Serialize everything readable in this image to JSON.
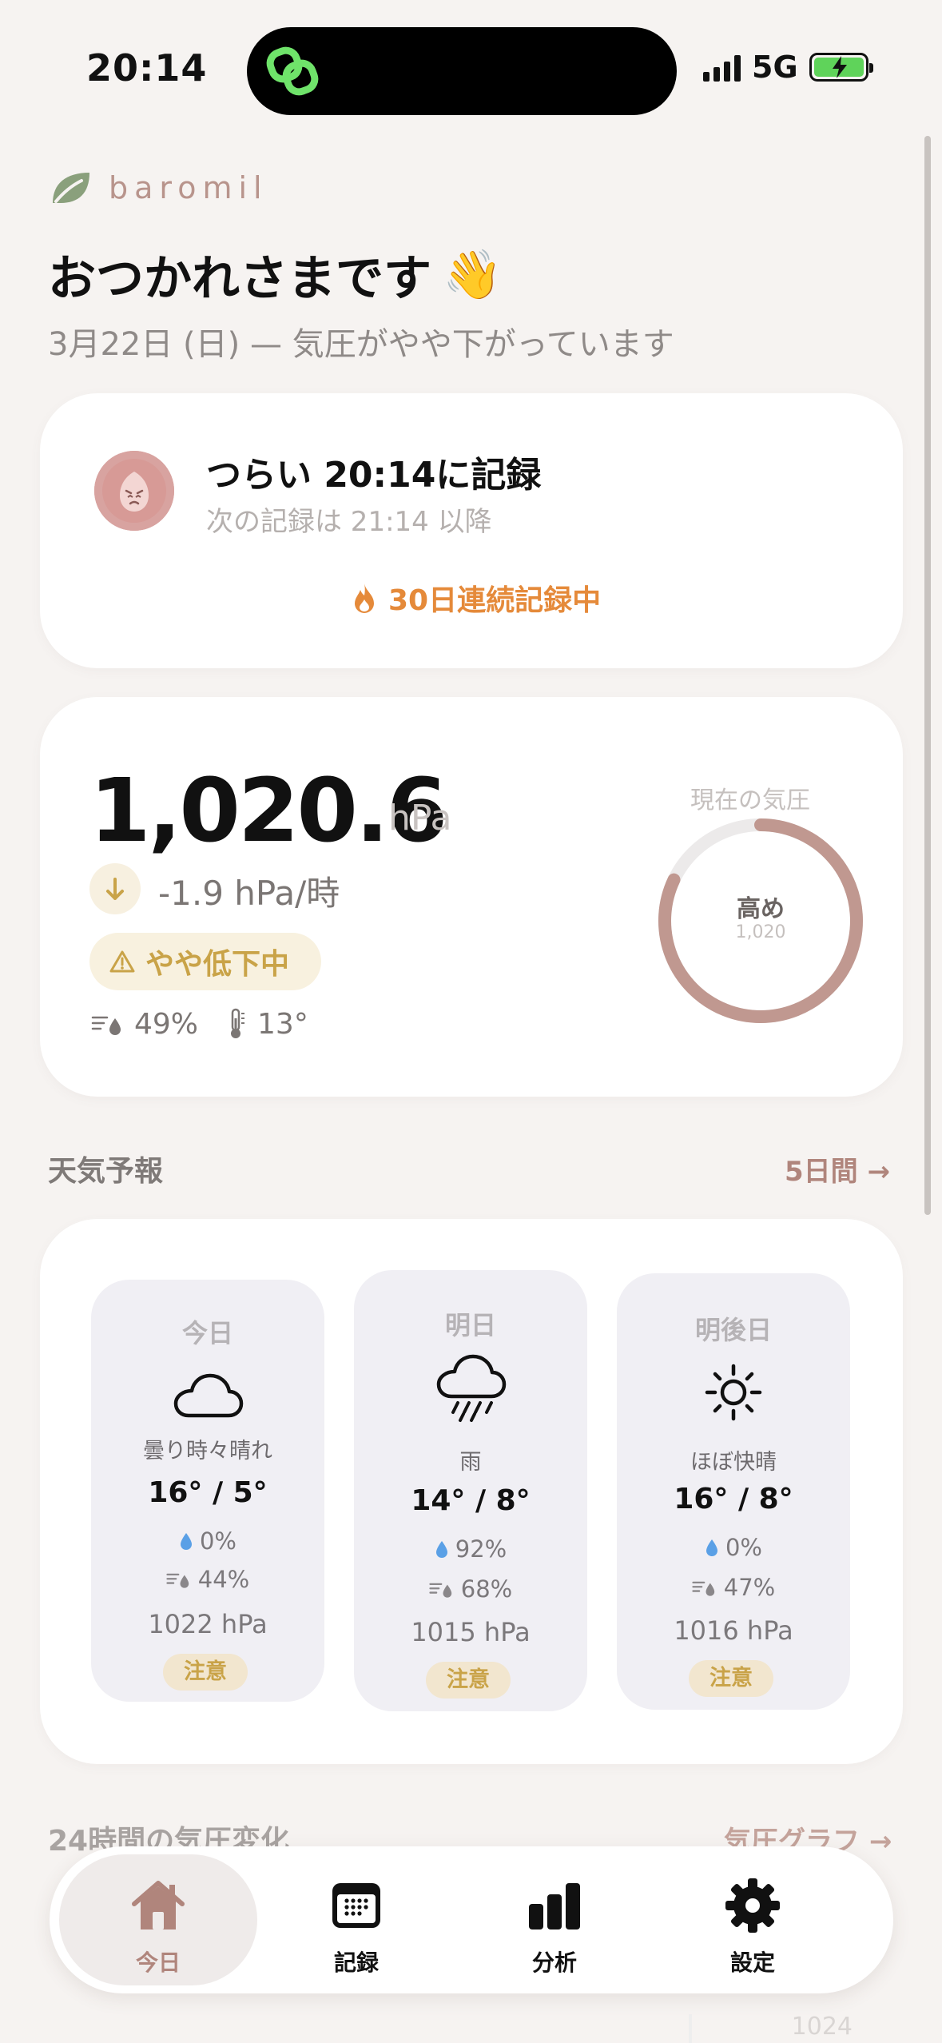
{
  "status": {
    "time": "20:14",
    "network": "5G"
  },
  "header": {
    "brand": "baromil",
    "greeting": "おつかれさまです",
    "greeting_emoji": "👋",
    "subtitle": "3月22日 (日) — 気圧がやや下がっています"
  },
  "log_card": {
    "mood": "つらい",
    "title": "つらい  20:14に記録",
    "next": "次の記録は 21:14 以降",
    "streak": "30日連続記録中",
    "face_color": "#d79a96"
  },
  "pressure": {
    "value": "1,020.6",
    "unit": "hPa",
    "trend": "-1.9 hPa/時",
    "trend_direction": "down",
    "alert": "やや低下中",
    "humidity": "49%",
    "temperature": "13°",
    "gauge_label": "現在の気圧",
    "gauge_level": "高め",
    "gauge_value": "1,020",
    "gauge_fill_fraction": 0.82,
    "gauge_color": "#c09890"
  },
  "forecast": {
    "title": "天気予報",
    "link": "5日間 →",
    "days": [
      {
        "label": "今日",
        "icon": "cloud-icon",
        "desc": "曇り時々晴れ",
        "temp": "16° / 5°",
        "rain": "0%",
        "humidity": "44%",
        "hpa": "1022 hPa",
        "badge": "注意"
      },
      {
        "label": "明日",
        "icon": "rain-cloud-icon",
        "desc": "雨",
        "temp": "14° / 8°",
        "rain": "92%",
        "humidity": "68%",
        "hpa": "1015 hPa",
        "badge": "注意"
      },
      {
        "label": "明後日",
        "icon": "sun-icon",
        "desc": "ほぼ快晴",
        "temp": "16° / 8°",
        "rain": "0%",
        "humidity": "47%",
        "hpa": "1016 hPa",
        "badge": "注意"
      }
    ]
  },
  "chart_section": {
    "title": "24時間の気圧変化",
    "link": "気圧グラフ →",
    "peek_value": "1024"
  },
  "tabs": [
    {
      "label": "今日",
      "icon": "home-icon",
      "active": true
    },
    {
      "label": "記録",
      "icon": "calendar-icon",
      "active": false
    },
    {
      "label": "分析",
      "icon": "bar-chart-icon",
      "active": false
    },
    {
      "label": "設定",
      "icon": "gear-icon",
      "active": false
    }
  ],
  "colors": {
    "accent": "#b0857c",
    "warning": "#c9a348",
    "streak": "#e58a3a",
    "background": "#f6f3f1"
  }
}
